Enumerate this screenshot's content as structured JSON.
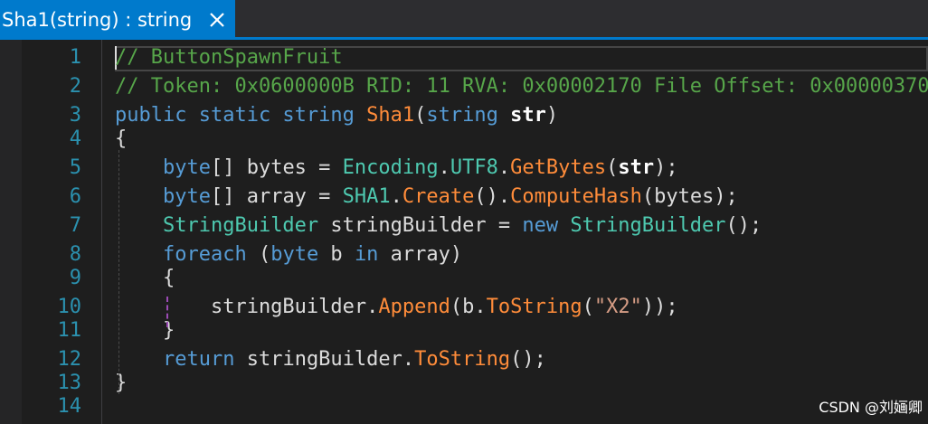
{
  "tab": {
    "title": "Sha1(string) : string"
  },
  "lines": [
    {
      "num": "1",
      "tokens": [
        {
          "t": "// ButtonSpawnFruit",
          "c": "c-comment"
        }
      ]
    },
    {
      "num": "2",
      "tokens": [
        {
          "t": "// Token: 0x0600000B RID: 11 RVA: 0x00002170 File Offset: 0x00000370",
          "c": "c-comment"
        }
      ]
    },
    {
      "num": "3",
      "tokens": [
        {
          "t": "public static string ",
          "c": "c-kw"
        },
        {
          "t": "Sha1",
          "c": "c-method"
        },
        {
          "t": "(",
          "c": ""
        },
        {
          "t": "string ",
          "c": "c-kw"
        },
        {
          "t": "str",
          "c": "bold"
        },
        {
          "t": ")",
          "c": ""
        }
      ]
    },
    {
      "num": "4",
      "tokens": [
        {
          "t": "{",
          "c": ""
        }
      ]
    },
    {
      "num": "5",
      "tokens": [
        {
          "t": "    ",
          "c": ""
        },
        {
          "t": "byte",
          "c": "c-kw"
        },
        {
          "t": "[] bytes = ",
          "c": ""
        },
        {
          "t": "Encoding",
          "c": "c-type"
        },
        {
          "t": ".",
          "c": ""
        },
        {
          "t": "UTF8",
          "c": "c-prop"
        },
        {
          "t": ".",
          "c": ""
        },
        {
          "t": "GetBytes",
          "c": "c-method"
        },
        {
          "t": "(",
          "c": ""
        },
        {
          "t": "str",
          "c": "bold"
        },
        {
          "t": ");",
          "c": ""
        }
      ]
    },
    {
      "num": "6",
      "tokens": [
        {
          "t": "    ",
          "c": ""
        },
        {
          "t": "byte",
          "c": "c-kw"
        },
        {
          "t": "[] array = ",
          "c": ""
        },
        {
          "t": "SHA1",
          "c": "c-type"
        },
        {
          "t": ".",
          "c": ""
        },
        {
          "t": "Create",
          "c": "c-method"
        },
        {
          "t": "().",
          "c": ""
        },
        {
          "t": "ComputeHash",
          "c": "c-method"
        },
        {
          "t": "(bytes);",
          "c": ""
        }
      ]
    },
    {
      "num": "7",
      "tokens": [
        {
          "t": "    ",
          "c": ""
        },
        {
          "t": "StringBuilder",
          "c": "c-type"
        },
        {
          "t": " stringBuilder = ",
          "c": ""
        },
        {
          "t": "new ",
          "c": "c-kw"
        },
        {
          "t": "StringBuilder",
          "c": "c-type"
        },
        {
          "t": "();",
          "c": ""
        }
      ]
    },
    {
      "num": "8",
      "tokens": [
        {
          "t": "    ",
          "c": ""
        },
        {
          "t": "foreach",
          "c": "c-kw"
        },
        {
          "t": " (",
          "c": ""
        },
        {
          "t": "byte",
          "c": "c-kw"
        },
        {
          "t": " b ",
          "c": ""
        },
        {
          "t": "in",
          "c": "c-kw"
        },
        {
          "t": " array)",
          "c": ""
        }
      ]
    },
    {
      "num": "9",
      "tokens": [
        {
          "t": "    {",
          "c": ""
        }
      ]
    },
    {
      "num": "10",
      "tokens": [
        {
          "t": "        stringBuilder.",
          "c": ""
        },
        {
          "t": "Append",
          "c": "c-method"
        },
        {
          "t": "(b.",
          "c": ""
        },
        {
          "t": "ToString",
          "c": "c-method"
        },
        {
          "t": "(",
          "c": ""
        },
        {
          "t": "\"X2\"",
          "c": "c-str"
        },
        {
          "t": "));",
          "c": ""
        }
      ]
    },
    {
      "num": "11",
      "tokens": [
        {
          "t": "    }",
          "c": ""
        }
      ]
    },
    {
      "num": "12",
      "tokens": [
        {
          "t": "    ",
          "c": ""
        },
        {
          "t": "return",
          "c": "c-kw"
        },
        {
          "t": " stringBuilder.",
          "c": ""
        },
        {
          "t": "ToString",
          "c": "c-method"
        },
        {
          "t": "();",
          "c": ""
        }
      ]
    },
    {
      "num": "13",
      "tokens": [
        {
          "t": "}",
          "c": ""
        }
      ]
    },
    {
      "num": "14",
      "tokens": []
    }
  ],
  "watermark": "CSDN @刘婳卿",
  "icons": {
    "close": "close-icon"
  },
  "colors": {
    "tab_accent": "#007acc",
    "editor_bg": "#1e1e1e",
    "comment": "#57a64a",
    "keyword": "#569cd6",
    "type": "#4ec9b0",
    "method": "#ff8c3a",
    "string": "#d69d85",
    "line_number": "#2b91af"
  }
}
